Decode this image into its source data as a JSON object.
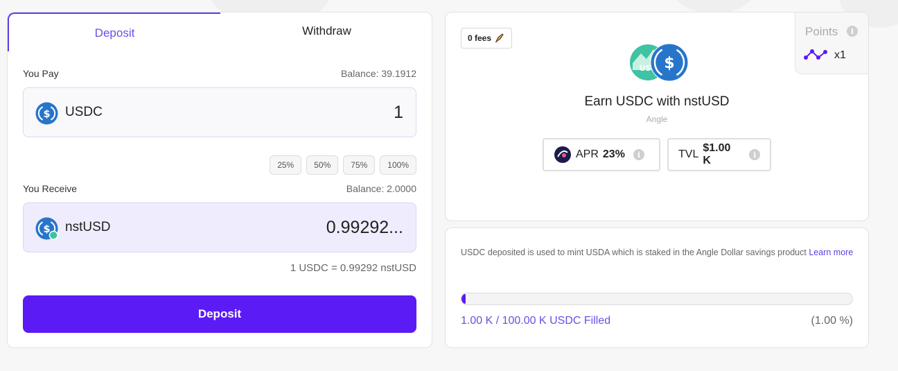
{
  "tabs": {
    "deposit": "Deposit",
    "withdraw": "Withdraw"
  },
  "pay": {
    "label": "You Pay",
    "balance": "Balance: 39.1912",
    "token": "USDC",
    "amount": "1",
    "percents": [
      "25%",
      "50%",
      "75%",
      "100%"
    ]
  },
  "receive": {
    "label": "You Receive",
    "balance": "Balance: 2.0000",
    "token": "nstUSD",
    "amount": "0.99292..."
  },
  "rate": "1 USDC = 0.99292 nstUSD",
  "deposit_button": "Deposit",
  "opportunity": {
    "fees_badge": "0 fees",
    "title": "Earn USDC with nstUSD",
    "protocol": "Angle",
    "apr_label": "APR",
    "apr_value": "23%",
    "tvl_label": "TVL",
    "tvl_value": "$1.00 K",
    "points_label": "Points",
    "points_mult": "x1",
    "hero_icon_text": "USI"
  },
  "info": {
    "text": "USDC deposited is used to mint USDA which is staked in the Angle Dollar savings product ",
    "link": "Learn more",
    "filled": "1.00 K / 100.00 K USDC Filled",
    "filled_pct": "(1.00 %)",
    "progress": 0.01
  },
  "colors": {
    "accent": "#5b1bf5",
    "usdc": "#2775ca"
  }
}
